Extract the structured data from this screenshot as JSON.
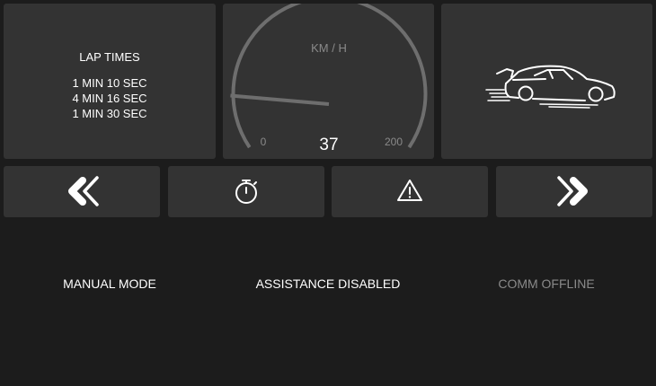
{
  "colors": {
    "background": "#1c1c1c",
    "panel": "#333333",
    "gauge": "#6e6e6e",
    "text": "#ffffff",
    "muted_text": "#8a8a8a"
  },
  "lap_times": {
    "title": "LAP TIMES",
    "entries": [
      "1 MIN 10 SEC",
      "4 MIN 16 SEC",
      "1 MIN 30 SEC"
    ]
  },
  "speedometer": {
    "unit_label": "KM / H",
    "min_label": "0",
    "max_label": "200",
    "value_label": "37",
    "min": 0,
    "max": 200,
    "value": 37
  },
  "car_panel": {
    "icon": "race-car-icon"
  },
  "controls": [
    {
      "name": "previous-button",
      "icon": "double-chevron-left-icon"
    },
    {
      "name": "stopwatch-button",
      "icon": "stopwatch-icon"
    },
    {
      "name": "warning-button",
      "icon": "warning-triangle-icon"
    },
    {
      "name": "next-button",
      "icon": "double-chevron-right-icon"
    }
  ],
  "status": {
    "mode": "MANUAL MODE",
    "assistance": "ASSISTANCE DISABLED",
    "comm": "COMM OFFLINE"
  }
}
